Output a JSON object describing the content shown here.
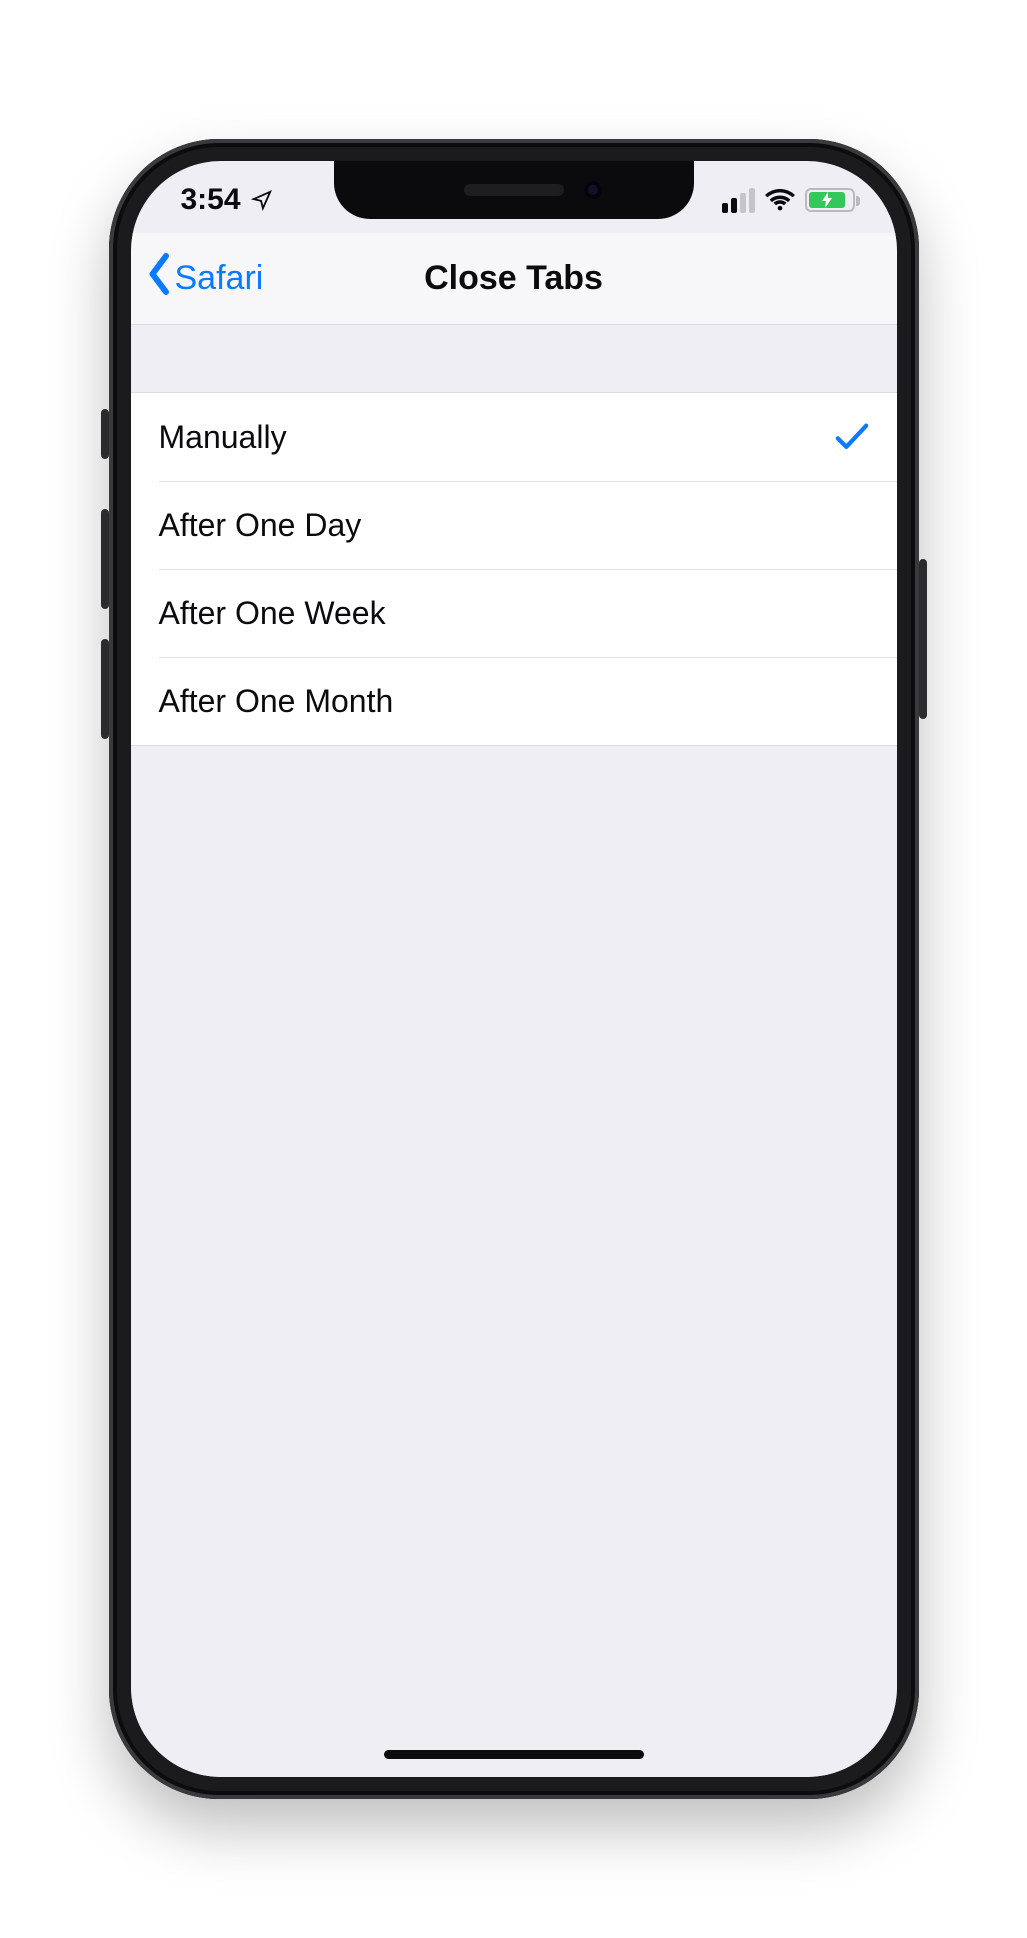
{
  "status": {
    "time": "3:54",
    "location_icon": "location-arrow-icon",
    "cell_bars_active": 2,
    "cell_bars_total": 4,
    "wifi_icon": "wifi-icon",
    "battery_icon": "battery-charging-icon",
    "battery_charging": true,
    "battery_color": "#34c759"
  },
  "nav": {
    "back_label": "Safari",
    "back_icon": "chevron-left-icon",
    "title": "Close Tabs"
  },
  "options": {
    "selected_index": 0,
    "check_icon": "checkmark-icon",
    "items": [
      {
        "label": "Manually"
      },
      {
        "label": "After One Day"
      },
      {
        "label": "After One Week"
      },
      {
        "label": "After One Month"
      }
    ]
  }
}
